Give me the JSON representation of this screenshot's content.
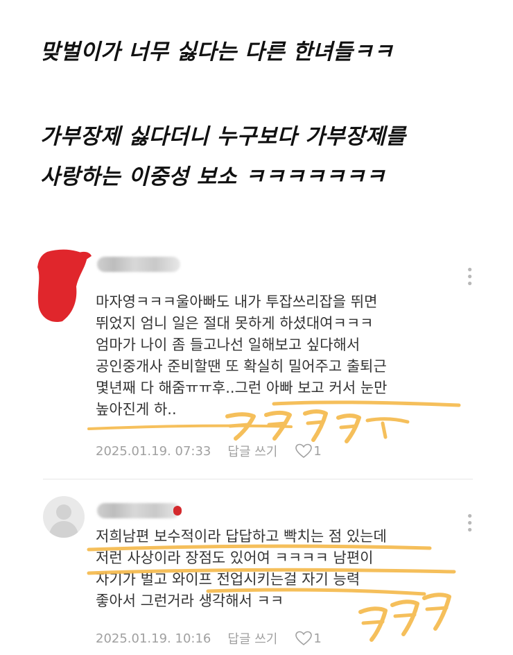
{
  "headline": {
    "line1": "맞벌이가 너무 싫다는 다른 한녀들ㅋㅋ",
    "line2": "가부장제 싫다더니 누구보다 가부장제를",
    "line3": "사랑하는 이중성 보소 ㅋㅋㅋㅋㅋㅋㅋ"
  },
  "comments": [
    {
      "lines": [
        "마자영ㅋㅋㅋ울아빠도 내가 투잡쓰리잡을 뛰면",
        "뛰었지 엄니 일은 절대 못하게 하셨대여ㅋㅋㅋ",
        "엄마가 나이 좀 들고나선 일해보고 싶다해서",
        "공인중개사 준비할땐 또 확실히 밀어주고 출퇴근",
        "몇년째 다 해줌ㅠㅠ후..그런 아빠 보고 커서 눈만",
        "높아진게 하.."
      ],
      "date": "2025.01.19. 07:33",
      "reply": "답글 쓰기",
      "likes": "1"
    },
    {
      "lines": [
        "저희남편 보수적이라 답답하고 빡치는 점 있는데",
        "저런 사상이라 장점도 있어여 ㅋㅋㅋㅋ 남편이",
        "자기가 벌고 와이프 전업시키는걸 자기 능력",
        "좋아서 그런거라 생각해서 ㅋㅋ"
      ],
      "date": "2025.01.19. 10:16",
      "reply": "답글 쓰기",
      "likes": "1"
    }
  ],
  "icons": {
    "more": "more-options-icon",
    "heart": "heart-icon",
    "avatar": "default-avatar-icon"
  },
  "colors": {
    "highlight": "#f5b94a",
    "censor_red": "#e0262c",
    "meta_gray": "#a0a0a0"
  }
}
